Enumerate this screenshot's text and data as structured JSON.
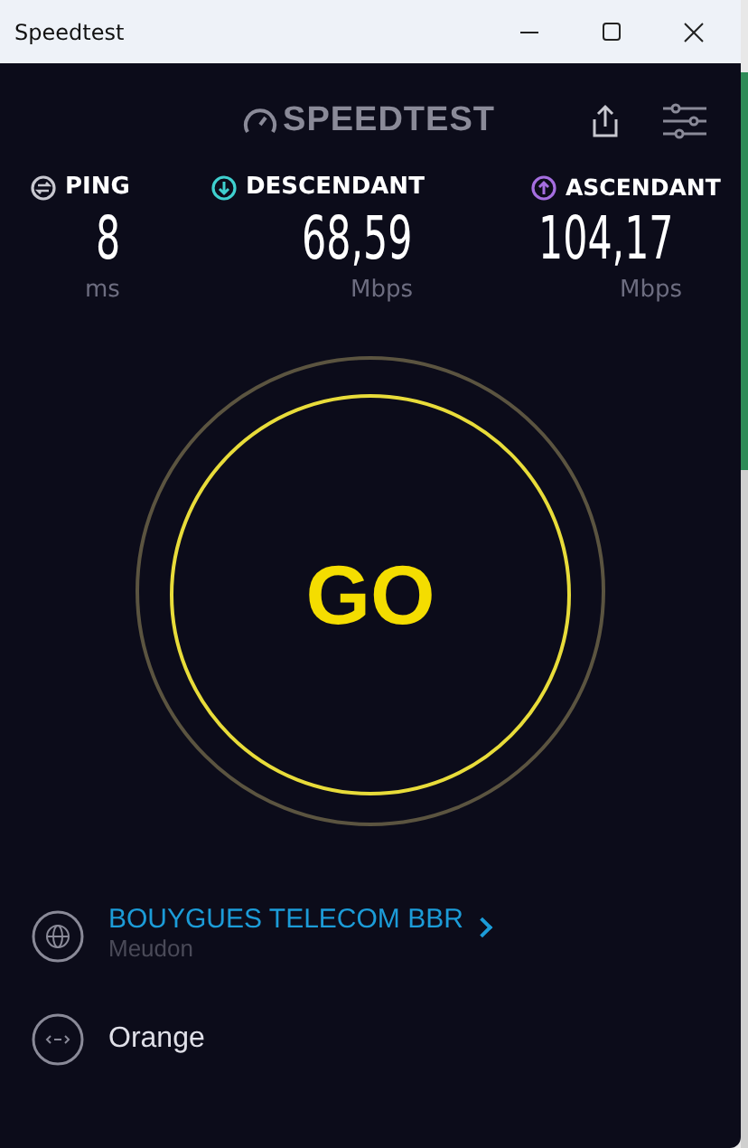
{
  "window": {
    "title": "Speedtest"
  },
  "header": {
    "logo": "SPEEDTEST"
  },
  "metrics": [
    {
      "kind": "ping",
      "label": "PING",
      "value": "8",
      "unit": "ms"
    },
    {
      "kind": "download",
      "label": "DESCENDANT",
      "value": "68,59",
      "unit": "Mbps"
    },
    {
      "kind": "upload",
      "label": "ASCENDANT",
      "value": "104,17",
      "unit": "Mbps"
    }
  ],
  "go_button": {
    "label": "GO"
  },
  "server": {
    "name": "BOUYGUES TELECOM BBR",
    "location": "Meudon"
  },
  "provider": {
    "name": "Orange"
  }
}
